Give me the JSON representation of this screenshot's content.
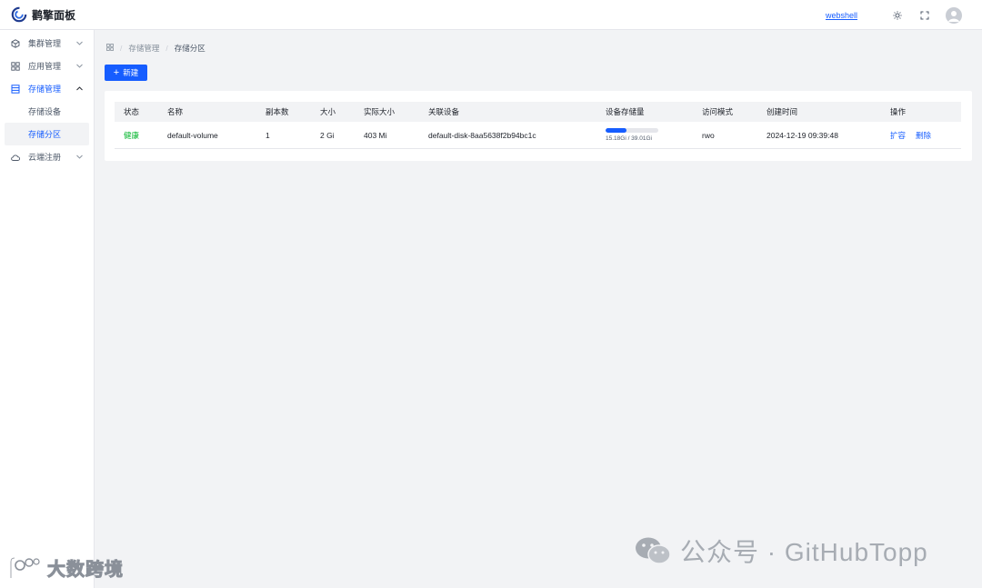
{
  "app": {
    "title": "鹳擎面板"
  },
  "header": {
    "webshell_label": "webshell"
  },
  "sidebar": {
    "items": [
      {
        "label": "集群管理",
        "icon": "cube-icon",
        "expanded": false
      },
      {
        "label": "应用管理",
        "icon": "grid-icon",
        "expanded": false
      },
      {
        "label": "存储管理",
        "icon": "storage-icon",
        "expanded": true,
        "children": [
          {
            "label": "存储设备"
          },
          {
            "label": "存储分区"
          }
        ]
      },
      {
        "label": "云端注册",
        "icon": "cloud-icon",
        "expanded": false
      }
    ]
  },
  "breadcrumb": {
    "level1": "存储管理",
    "level2": "存储分区"
  },
  "toolbar": {
    "new_label": "新建"
  },
  "table": {
    "headers": {
      "status": "状态",
      "name": "名称",
      "replicas": "副本数",
      "size": "大小",
      "actual_size": "实际大小",
      "device": "关联设备",
      "device_storage": "设备存储量",
      "access_mode": "访问模式",
      "created": "创建时间",
      "actions": "操作"
    },
    "rows": [
      {
        "status": "健康",
        "name": "default-volume",
        "replicas": "1",
        "size": "2 Gi",
        "actual_size": "403 Mi",
        "device": "default-disk-8aa5638f2b94bc1c",
        "storage_used_fraction": 0.39,
        "storage_text": "15.18Gi / 39.01Gi",
        "access_mode": "rwo",
        "created": "2024-12-19 09:39:48",
        "action_expand": "扩容",
        "action_delete": "删除"
      }
    ]
  },
  "watermarks": {
    "right": "公众号 · GitHubTopp",
    "left": "大数跨境"
  },
  "colors": {
    "primary": "#165dff",
    "success": "#00b42a",
    "background": "#f2f3f5"
  }
}
